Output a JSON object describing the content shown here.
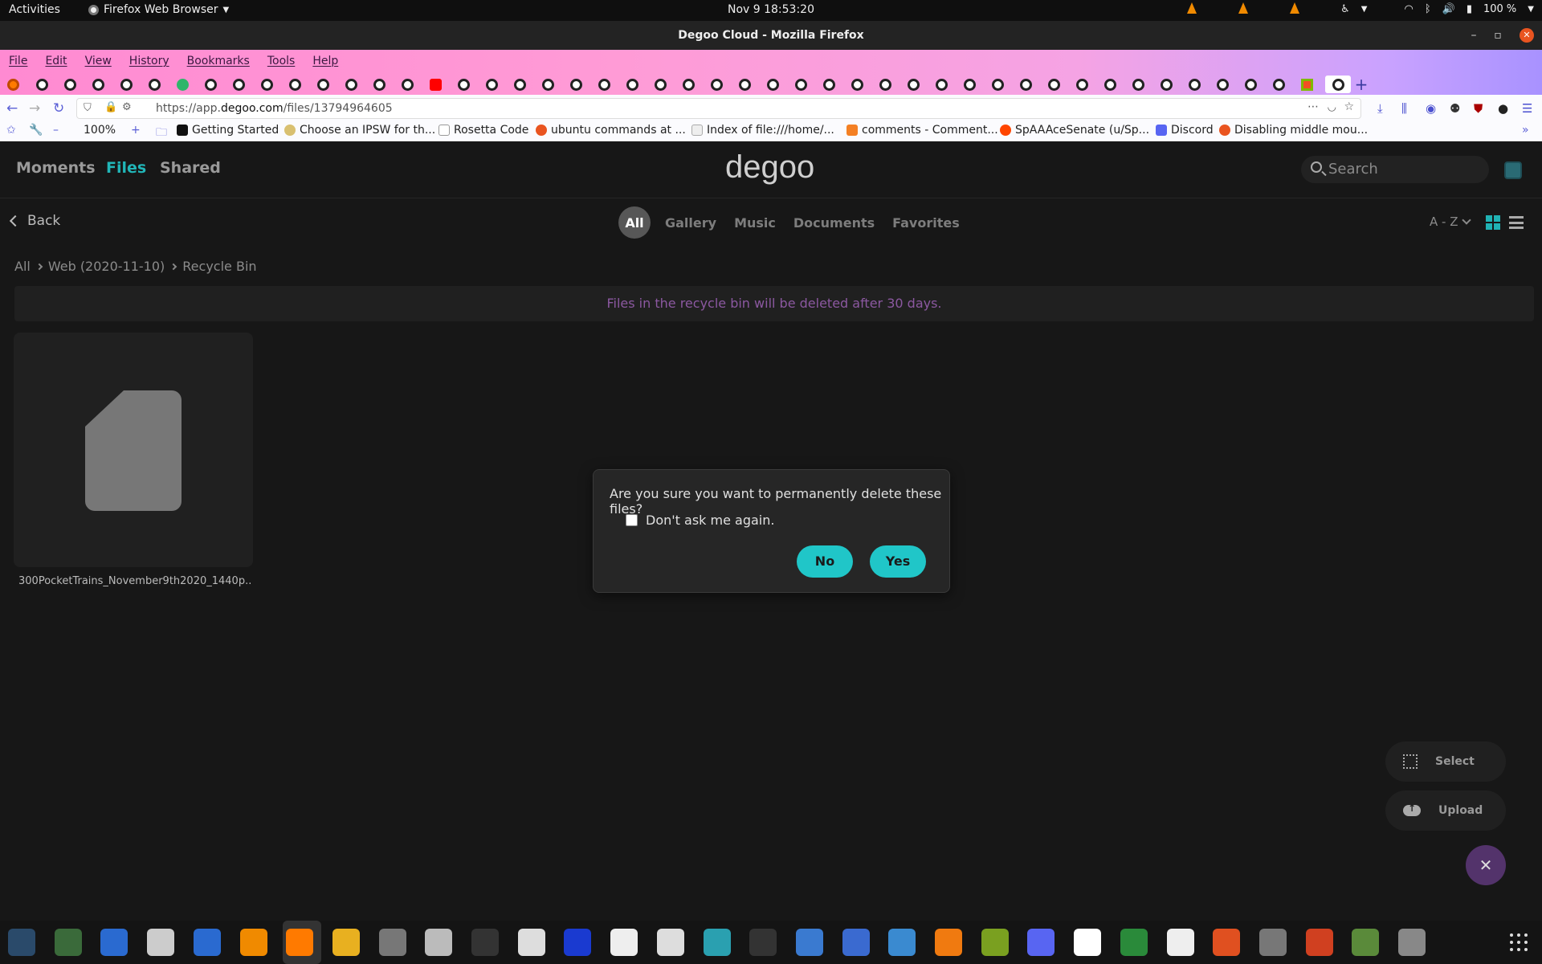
{
  "system": {
    "activities": "Activities",
    "app_name": "Firefox Web Browser",
    "clock": "Nov 9  18:53:20",
    "battery": "100 %"
  },
  "window": {
    "title": "Degoo Cloud - Mozilla Firefox"
  },
  "menu": [
    "File",
    "Edit",
    "View",
    "History",
    "Bookmarks",
    "Tools",
    "Help"
  ],
  "browser": {
    "url_prefix": "https://app.",
    "url_domain": "degoo.com",
    "url_path": "/files/13794964605",
    "zoom": "100%"
  },
  "bookmarks": [
    {
      "label": "Getting Started",
      "icon": "medium-icon"
    },
    {
      "label": "Choose an IPSW for th...",
      "icon": "ipsw-icon"
    },
    {
      "label": "Rosetta Code",
      "icon": "rosetta-icon"
    },
    {
      "label": "ubuntu commands at ...",
      "icon": "ubuntu-icon"
    },
    {
      "label": "Index of file:///home/...",
      "icon": "file-icon"
    },
    {
      "label": "comments - Comment...",
      "icon": "stackoverflow-icon"
    },
    {
      "label": "SpAAAceSenate (u/Sp...",
      "icon": "reddit-icon"
    },
    {
      "label": "Discord",
      "icon": "discord-icon"
    },
    {
      "label": "Disabling middle mou...",
      "icon": "askubuntu-icon"
    }
  ],
  "app": {
    "nav": {
      "moments": "Moments",
      "files": "Files",
      "shared": "Shared"
    },
    "logo": "degoo",
    "search_placeholder": "Search",
    "back": "Back",
    "filters": {
      "all": "All",
      "gallery": "Gallery",
      "music": "Music",
      "documents": "Documents",
      "favorites": "Favorites"
    },
    "sort": "A - Z",
    "breadcrumb": [
      "All",
      "Web (2020-11-10)",
      "Recycle Bin"
    ],
    "notice": "Files in the recycle bin will be deleted after 30 days.",
    "file": {
      "name": "300PocketTrains_November9th2020_1440p...."
    },
    "select_label": "Select",
    "upload_label": "Upload"
  },
  "dialog": {
    "question": "Are you sure you want to permanently delete these files?",
    "checkbox_label": "Don't ask me again.",
    "no": "No",
    "yes": "Yes"
  },
  "colors": {
    "accent": "#20c6c8",
    "files_active": "#21b6b8",
    "notice_text": "#8b58a0",
    "close_fab": "#53336b"
  }
}
